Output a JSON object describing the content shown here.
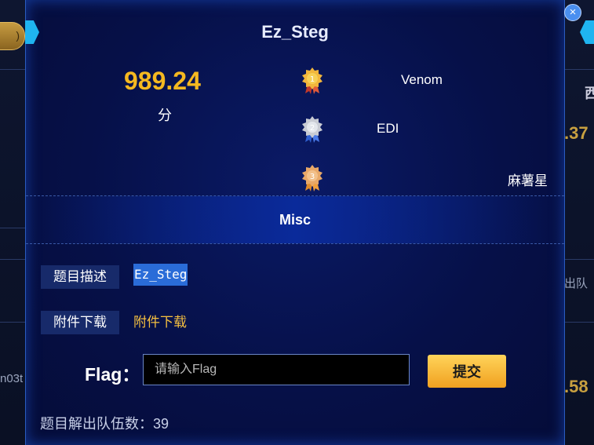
{
  "modal": {
    "title": "Ez_Steg",
    "close_label": "×",
    "score": "989.24",
    "score_unit": "分",
    "ranks": [
      {
        "place": "1",
        "name": "Venom",
        "medal": "gold-medal-icon"
      },
      {
        "place": "2",
        "name": "EDI",
        "medal": "silver-medal-icon"
      },
      {
        "place": "3",
        "name": "麻薯星",
        "medal": "bronze-medal-icon"
      }
    ],
    "category": "Misc",
    "description_label": "题目描述",
    "description_value": "Ez_Steg",
    "attachment_label": "附件下载",
    "attachment_link": "附件下载",
    "flag_label": "Flag：",
    "flag_placeholder": "请输入Flag",
    "flag_value": "",
    "submit_label": "提交",
    "solved_text": "题目解出队伍数：39"
  },
  "background": {
    "left_snippet": "n03t",
    "right_values": [
      ".37",
      ".58"
    ],
    "right_char": "西",
    "right_text": "出队"
  },
  "colors": {
    "score": "#f5b820",
    "accent_link": "#f5c040",
    "submit": "#f5b030",
    "modal_bg": "#061048"
  }
}
